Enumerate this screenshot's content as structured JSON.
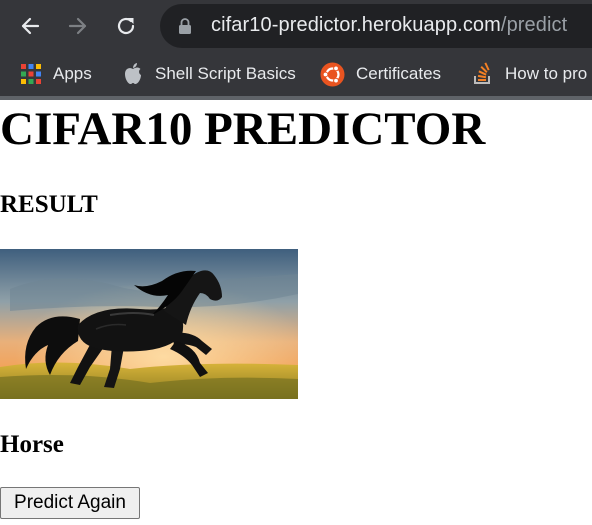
{
  "browser": {
    "url_host": "cifar10-predictor.herokuapp.com",
    "url_path": "/predict",
    "nav_icons": [
      "back-arrow-icon",
      "forward-arrow-icon",
      "reload-icon",
      "lock-icon"
    ],
    "bookmarks": [
      {
        "label": "Apps",
        "icon": "apps-grid-icon"
      },
      {
        "label": "Shell Script Basics",
        "icon": "apple-icon"
      },
      {
        "label": "Certificates",
        "icon": "ubuntu-icon"
      },
      {
        "label": "How to pro",
        "icon": "stackoverflow-icon"
      }
    ],
    "colors": {
      "toolbar": "#35363a",
      "omnibox": "#202124",
      "text": "#e8eaed",
      "muted": "#9aa0a6"
    }
  },
  "page": {
    "title": "CIFAR10 PREDICTOR",
    "result_heading": "RESULT",
    "image_subject": "black horse rearing at sunset",
    "prediction": "Horse",
    "button_label": "Predict Again"
  }
}
